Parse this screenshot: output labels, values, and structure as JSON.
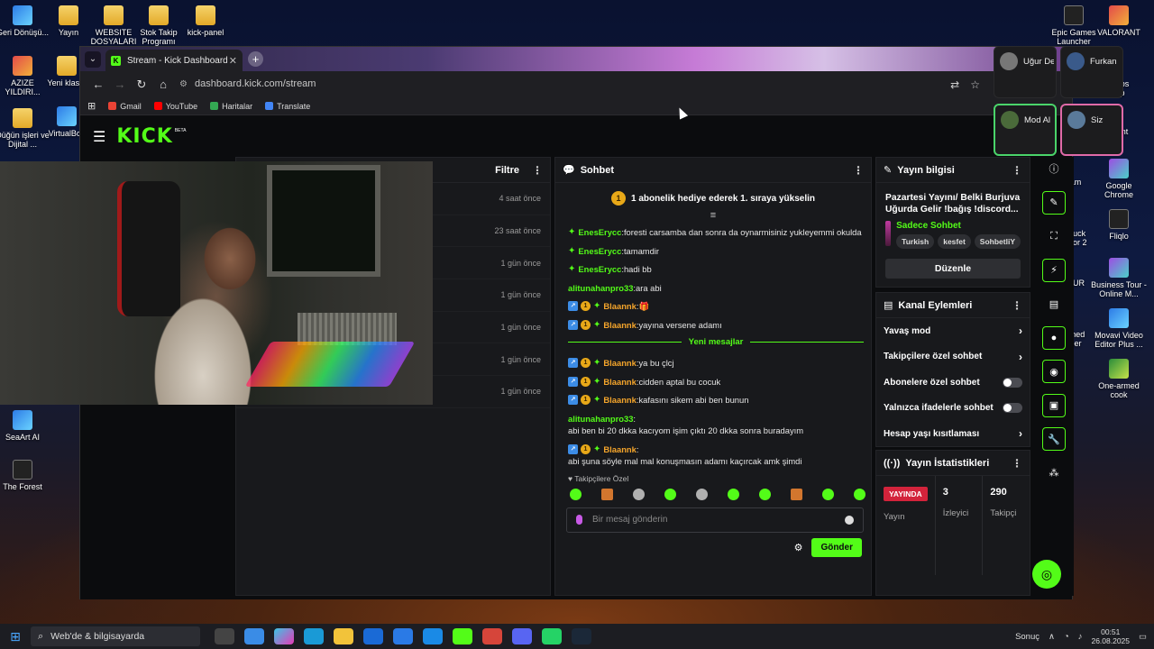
{
  "desktop": {
    "left_icons": [
      {
        "label": "Geri Dönüşü..."
      },
      {
        "label": "AZIZE YILDIRI..."
      },
      {
        "label": "Düğün işleri ve Dijital ..."
      },
      {
        "label": "SeaArt AI"
      },
      {
        "label": "The Forest"
      }
    ],
    "top_icons": [
      {
        "label": "Yayın"
      },
      {
        "label": "WEBSITE DOSYALARI"
      },
      {
        "label": "Stok Takip Programı"
      },
      {
        "label": "kick-panel"
      }
    ],
    "mid_icons": [
      {
        "label": "Yeni klas..."
      },
      {
        "label": "VirtualBox"
      }
    ],
    "right_icons": [
      {
        "label": "Epic Games Launcher"
      },
      {
        "label": "VALORANT"
      },
      {
        "label": "Google Chrome"
      },
      {
        "label": "Fliqlo"
      },
      {
        "label": "Business Tour - Online M..."
      },
      {
        "label": "Movavi Video Editor Plus ..."
      },
      {
        "label": "One-armed cook"
      }
    ],
    "right_partial": [
      "abs",
      "p",
      "ent",
      "am",
      "Truck",
      "lator 2",
      "OUR",
      "rmed",
      "ber"
    ]
  },
  "browser": {
    "tab_title": "Stream - Kick Dashboard",
    "tab_favicon": "K",
    "url": "dashboard.kick.com/stream",
    "bookmarks": [
      {
        "label": "Gmail",
        "color": "#ea4335"
      },
      {
        "label": "YouTube",
        "color": "#ff0000"
      },
      {
        "label": "Haritalar",
        "color": "#34a853"
      },
      {
        "label": "Translate",
        "color": "#4285f4"
      }
    ]
  },
  "kick": {
    "logo": "KICK",
    "logo_beta": "BETA",
    "events_panel": {
      "title": "Filtre",
      "rows": [
        "4 saat önce",
        "23 saat önce",
        "1 gün önce",
        "1 gün önce",
        "1 gün önce",
        "1 gün önce",
        "1 gün önce"
      ]
    },
    "chat": {
      "title": "Sohbet",
      "banner_num": "1",
      "banner_text": "1 abonelik hediye ederek 1. sıraya yükselin",
      "messages": [
        {
          "user": "EnesErycc",
          "color": "teal",
          "badges": [
            "green"
          ],
          "text": "foresti carsamba dan sonra da oynarmisiniz yukleyemmi okulda"
        },
        {
          "user": "EnesErycc",
          "color": "teal",
          "badges": [
            "green"
          ],
          "text": "tamamdir"
        },
        {
          "user": "EnesErycc",
          "color": "teal",
          "badges": [
            "green"
          ],
          "text": "hadi bb"
        },
        {
          "user": "alitunahanpro33",
          "color": "green",
          "badges": [],
          "text": "ara abi"
        },
        {
          "user": "Blaannk",
          "color": "orange",
          "badges": [
            "blue",
            "gold",
            "green"
          ],
          "text": "🎁"
        },
        {
          "user": "Blaannk",
          "color": "orange",
          "badges": [
            "blue",
            "gold",
            "green"
          ],
          "text": "yayına versene adamı"
        }
      ],
      "new_messages_label": "Yeni mesajlar",
      "new_messages": [
        {
          "user": "Blaannk",
          "color": "orange",
          "badges": [
            "blue",
            "gold",
            "green"
          ],
          "text": "ya bu çlcj"
        },
        {
          "user": "Blaannk",
          "color": "orange",
          "badges": [
            "blue",
            "gold",
            "green"
          ],
          "text": "cidden aptal bu cocuk"
        },
        {
          "user": "Blaannk",
          "color": "orange",
          "badges": [
            "blue",
            "gold",
            "green"
          ],
          "text": "kafasını sikem abi ben bunun"
        },
        {
          "user": "alitunahanpro33",
          "color": "green",
          "badges": [],
          "text": "abi ben bi 20 dkka kacıyom işim çıktı 20 dkka sonra buradayım"
        },
        {
          "user": "Blaannk",
          "color": "orange",
          "badges": [
            "blue",
            "gold",
            "green"
          ],
          "text": "abi şuna söyle mal mal konuşmasın adamı kaçırcak amk şimdi"
        }
      ],
      "followers_only": "Takipçilere Özel",
      "input_placeholder": "Bir mesaj gönderin",
      "send_label": "Gönder"
    },
    "stream_info": {
      "title": "Yayın bilgisi",
      "stream_title": "Pazartesi Yayını/ Belki Burjuva Uğurda Gelir !bağış !discord...",
      "category": "Sadece Sohbet",
      "tags": [
        "Turkish",
        "kesfet",
        "SohbetliY"
      ],
      "edit_label": "Düzenle"
    },
    "channel_actions": {
      "title": "Kanal Eylemleri",
      "items": [
        {
          "label": "Yavaş mod",
          "control": "chevron"
        },
        {
          "label": "Takipçilere özel sohbet",
          "control": "chevron"
        },
        {
          "label": "Abonelere özel sohbet",
          "control": "toggle"
        },
        {
          "label": "Yalnızca ifadelerle sohbet",
          "control": "toggle"
        },
        {
          "label": "Hesap yaşı kısıtlaması",
          "control": "chevron"
        }
      ]
    },
    "stats": {
      "title": "Yayın İstatistikleri",
      "live_badge": "YAYINDA",
      "live_label": "Yayın",
      "viewers_value": "3",
      "viewers_label": "İzleyici",
      "followers_value": "290",
      "followers_label": "Takipçi"
    }
  },
  "call": {
    "tiles": [
      {
        "name": "Uğur De"
      },
      {
        "name": "Furkan"
      },
      {
        "name": "Mod Al"
      },
      {
        "name": "Siz"
      }
    ]
  },
  "taskbar": {
    "search_placeholder": "Web'de & bilgisayarda",
    "tray_text": "Sonuç",
    "time": "00:51",
    "date": "26.08.2025"
  }
}
